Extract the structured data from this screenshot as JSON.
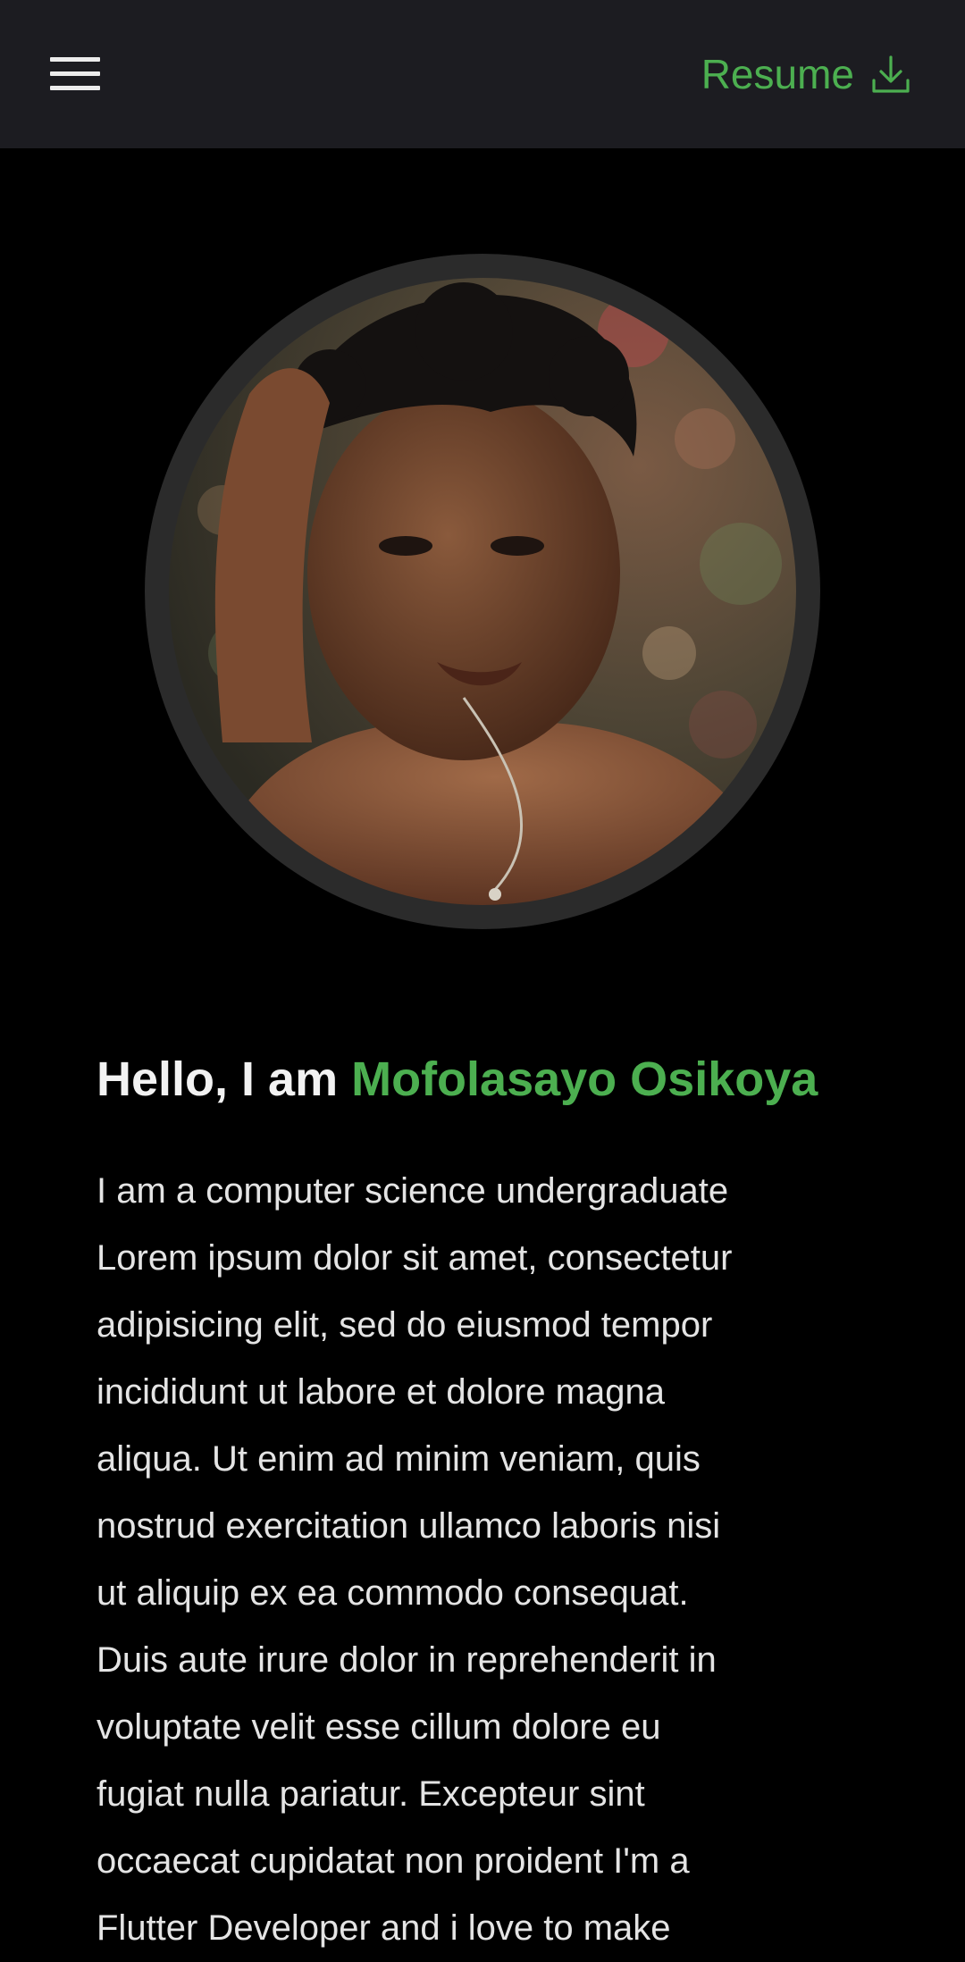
{
  "appbar": {
    "menu_icon": "hamburger-menu-icon",
    "resume_label": "Resume",
    "resume_icon": "download-icon"
  },
  "profile": {
    "photo": "portrait-photo",
    "greeting": "Hello, I am",
    "name": "Mofolasayo Osikoya",
    "bio": "I am a computer science undergraduate\nLorem ipsum dolor sit amet, consectetur\nadipisicing elit, sed do eiusmod tempor\nincididunt ut labore et dolore magna\naliqua. Ut enim ad minim veniam, quis\nnostrud exercitation ullamco laboris nisi\nut aliquip ex ea commodo consequat.\nDuis aute irure dolor in reprehenderit in\nvoluptate velit esse cillum dolore eu\nfugiat nulla pariatur. Excepteur sint\noccaecat cupidatat non proident  I'm a\nFlutter Developer and i love to make"
  },
  "colors": {
    "background": "#000000",
    "appbar": "#1c1c21",
    "accent": "#4caf50",
    "ring": "#2b2b2b",
    "text": "#e4e4e4"
  }
}
